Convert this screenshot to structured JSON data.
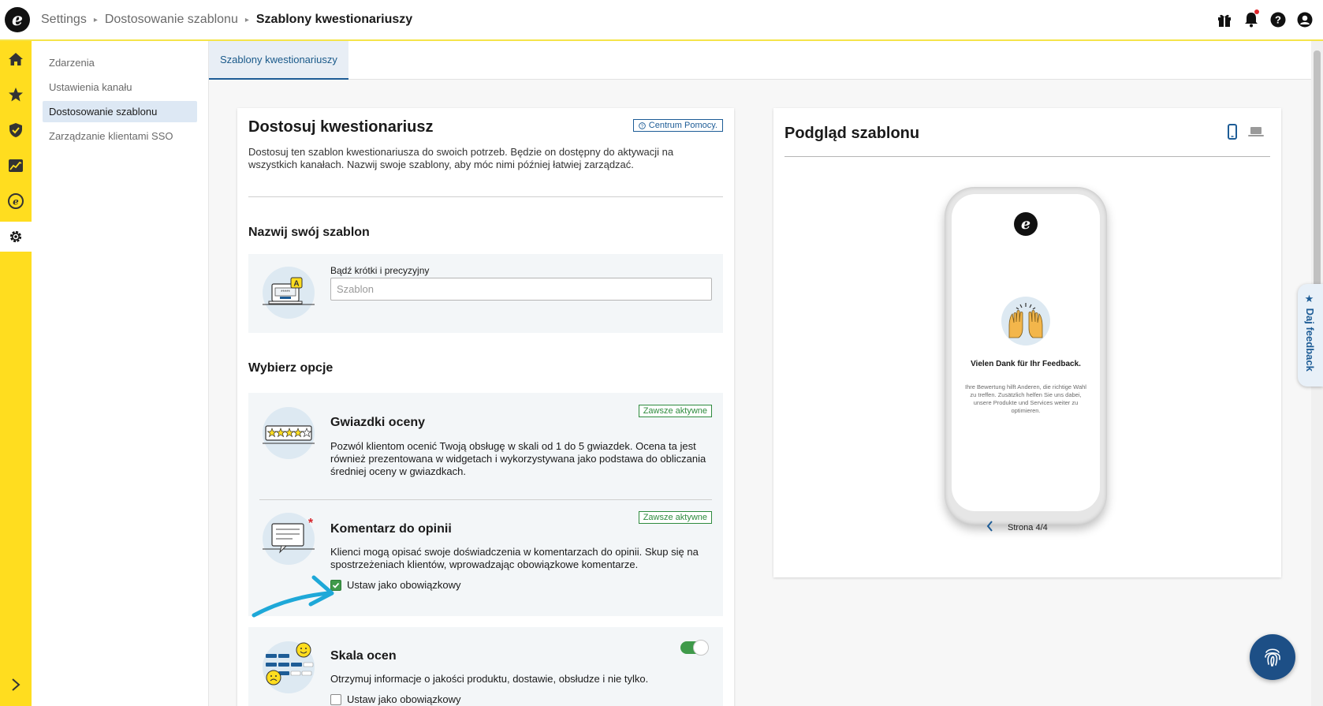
{
  "breadcrumb": {
    "items": [
      "Settings",
      "Dostosowanie szablonu",
      "Szablony kwestionariuszy"
    ]
  },
  "subnav": {
    "items": [
      {
        "label": "Zdarzenia"
      },
      {
        "label": "Ustawienia kanału"
      },
      {
        "label": "Dostosowanie szablonu",
        "active": true
      },
      {
        "label": "Zarządzanie klientami SSO"
      }
    ]
  },
  "tabs": [
    {
      "label": "Szablony kwestionariuszy",
      "active": true
    }
  ],
  "editor": {
    "title": "Dostosuj kwestionariusz",
    "help_label": "Centrum Pomocy.",
    "description": "Dostosuj ten szablon kwestionariusza do swoich potrzeb. Będzie on dostępny do aktywacji na wszystkich kanałach. Nazwij swoje szablony, aby móc nimi później łatwiej zarządzać.",
    "name_section": {
      "title": "Nazwij swój szablon",
      "field_label": "Bądź krótki i precyzyjny",
      "placeholder": "Szablon",
      "value": ""
    },
    "options_section": {
      "title": "Wybierz opcje",
      "options": [
        {
          "title": "Gwiazdki oceny",
          "badge": "Zawsze aktywne",
          "description": "Pozwól klientom ocenić Twoją obsługę w skali od 1 do 5 gwiazdek. Ocena ta jest również prezentowana w widgetach i wykorzystywana jako podstawa do obliczania średniej oceny w gwiazdkach."
        },
        {
          "title": "Komentarz do opinii",
          "badge": "Zawsze aktywne",
          "description": "Klienci mogą opisać swoje doświadczenia w komentarzach do opinii. Skup się na spostrzeżeniach klientów, wprowadzając obowiązkowe komentarze.",
          "checkbox_label": "Ustaw jako obowiązkowy",
          "checked": true
        },
        {
          "title": "Skala ocen",
          "description": "Otrzymuj informacje o jakości produktu, dostawie, obsłudze i nie tylko.",
          "checkbox_label": "Ustaw jako obowiązkowy",
          "checked": false,
          "toggle_on": true
        }
      ]
    }
  },
  "preview": {
    "title": "Podgląd szablonu",
    "thanks_title": "Vielen Dank für Ihr Feedback.",
    "thanks_text": "Ihre Bewertung hilft Anderen, die richtige Wahl zu treffen. Zusätzlich helfen Sie uns dabei, unsere Produkte und Services weiter zu optimieren.",
    "page_label": "Strona 4/4",
    "selected_device": "mobile"
  },
  "feedback_tab": {
    "label": "Daj feedback"
  },
  "colors": {
    "rail": "#ffdd1f",
    "accent_blue": "#1d5c96",
    "success_green": "#3f9a4a",
    "annotation_arrow": "#1ea8d8"
  }
}
